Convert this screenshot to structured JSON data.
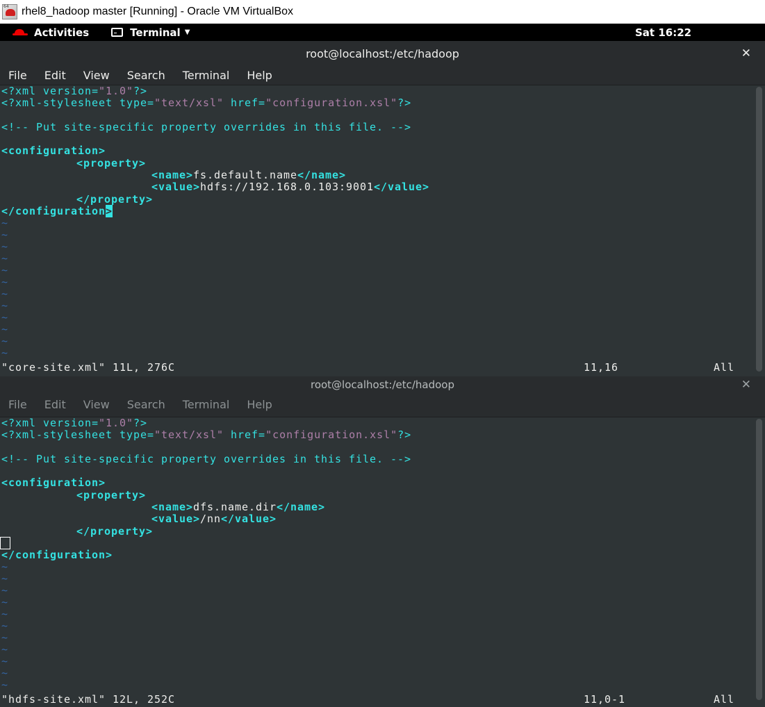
{
  "vbox": {
    "title": "rhel8_hadoop master [Running] - Oracle VM VirtualBox"
  },
  "topbar": {
    "activities": "Activities",
    "app": "Terminal",
    "clock": "Sat 16:22"
  },
  "colors": {
    "bg": "#2e3436",
    "cyan": "#34e2e2",
    "purple": "#ad7fa8",
    "tilde": "#3465a4"
  },
  "menu": [
    "File",
    "Edit",
    "View",
    "Search",
    "Terminal",
    "Help"
  ],
  "window1": {
    "title": "root@localhost:/etc/hadoop",
    "xml_decl": {
      "open": "<?xml version=",
      "ver": "\"1.0\"",
      "close": "?>"
    },
    "stylesheet": {
      "open": "<?xml-stylesheet type=",
      "type": "\"text/xsl\"",
      "href_attr": " href=",
      "href": "\"configuration.xsl\"",
      "close": "?>"
    },
    "comment": "<!-- Put site-specific property overrides in this file. -->",
    "config_open": "<configuration>",
    "property_open": "<property>",
    "name_open": "<name>",
    "name_value": "fs.default.name",
    "name_close": "</name>",
    "value_open": "<value>",
    "value_text": "hdfs://192.168.0.103:9001",
    "value_close": "</value>",
    "property_close": "</property>",
    "config_close_main": "</configuration",
    "config_close_cursor": ">",
    "status_file": "\"core-site.xml\" 11L, 276C",
    "status_pos": "11,16",
    "status_scroll": "All"
  },
  "window2": {
    "title": "root@localhost:/etc/hadoop",
    "xml_decl": {
      "open": "<?xml version=",
      "ver": "\"1.0\"",
      "close": "?>"
    },
    "stylesheet": {
      "open": "<?xml-stylesheet type=",
      "type": "\"text/xsl\"",
      "href_attr": " href=",
      "href": "\"configuration.xsl\"",
      "close": "?>"
    },
    "comment": "<!-- Put site-specific property overrides in this file. -->",
    "config_open": "<configuration>",
    "property_open": "<property>",
    "name_open": "<name>",
    "name_value": "dfs.name.dir",
    "name_close": "</name>",
    "value_open": "<value>",
    "value_text": "/nn",
    "value_close": "</value>",
    "property_close": "</property>",
    "config_close": "</configuration>",
    "status_file": "\"hdfs-site.xml\" 12L, 252C",
    "status_pos": "11,0-1",
    "status_scroll": "All"
  },
  "tilde": "~"
}
